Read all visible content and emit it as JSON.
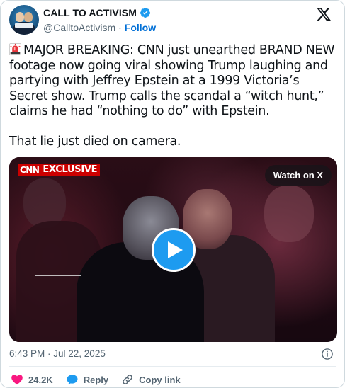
{
  "author": {
    "display_name": "CALL TO ACTIVISM",
    "handle": "@CalltoActivism",
    "separator": "·",
    "follow_label": "Follow"
  },
  "tweet": {
    "paragraph1": "MAJOR BREAKING: CNN just unearthed BRAND NEW footage now going viral showing Trump laughing and partying with Jeffrey Epstein at a 1999 Victoria’s Secret show. Trump calls the scandal a “witch hunt,” claims he had “nothing to do” with Epstein.",
    "paragraph2": "That lie just died on camera.",
    "leading_icon": "siren-emoji"
  },
  "video": {
    "badge_logo": "CNN",
    "badge_text": "EXCLUSIVE",
    "watch_label": "Watch on X"
  },
  "timestamp": "6:43 PM · Jul 22, 2025",
  "actions": {
    "like_count": "24.2K",
    "reply_label": "Reply",
    "copy_label": "Copy link"
  },
  "colors": {
    "accent": "#1d9bf0",
    "like": "#f91880",
    "link": "#006fd6",
    "cnn_red": "#cc0000"
  }
}
